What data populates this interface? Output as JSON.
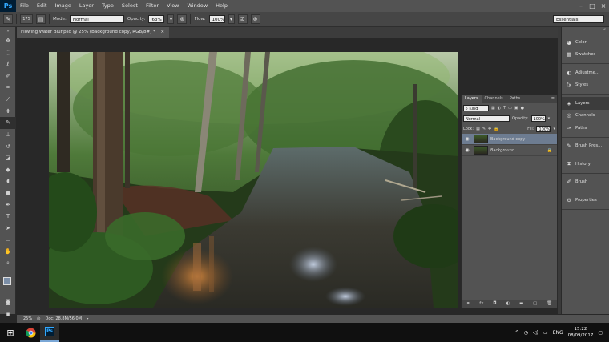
{
  "app": {
    "logo": "Ps"
  },
  "menu": [
    "File",
    "Edit",
    "Image",
    "Layer",
    "Type",
    "Select",
    "Filter",
    "View",
    "Window",
    "Help"
  ],
  "options_bar": {
    "brush_size": "175",
    "mode_label": "Mode:",
    "mode_value": "Normal",
    "opacity_label": "Opacity:",
    "opacity_value": "63%",
    "flow_label": "Flow:",
    "flow_value": "100%",
    "workspace": "Essentials"
  },
  "document": {
    "tab_title": "Flowing Water Blur.psd @ 25% (Background copy, RGB/8#) *",
    "close": "×"
  },
  "status": {
    "zoom": "25%",
    "doc_size": "Doc: 28.8M/56.0M"
  },
  "layers_panel": {
    "tabs": [
      "Layers",
      "Channels",
      "Paths"
    ],
    "kind_label": "Kind",
    "blend_mode": "Normal",
    "opacity_label": "Opacity:",
    "opacity_value": "100%",
    "lock_label": "Lock:",
    "fill_label": "Fill:",
    "fill_value": "100%",
    "layers": [
      {
        "name": "Background copy",
        "selected": true
      },
      {
        "name": "Background",
        "selected": false
      }
    ]
  },
  "dock": {
    "groups": [
      [
        "Color",
        "Swatches"
      ],
      [
        "Adjustme...",
        "Styles"
      ],
      [
        "Layers",
        "Channels",
        "Paths"
      ],
      [
        "Brush Pres..."
      ],
      [
        "History"
      ],
      [
        "Brush"
      ],
      [
        "Properties"
      ]
    ]
  },
  "taskbar": {
    "language": "ENG",
    "time": "15:22",
    "date": "08/09/2017",
    "ps_icon": "Ps"
  }
}
